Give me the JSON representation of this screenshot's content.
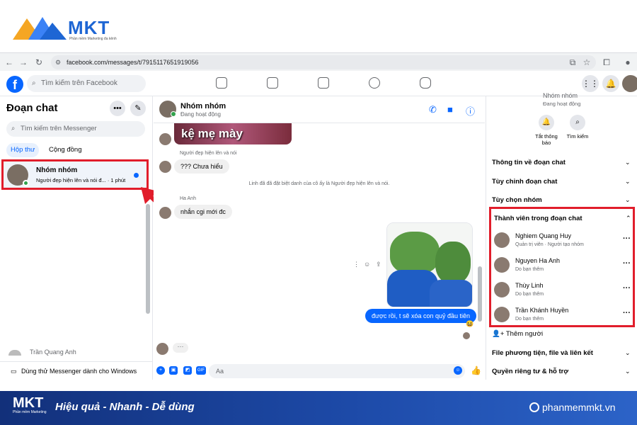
{
  "brand": {
    "logo": "MKT",
    "tagline": "Phần mềm Marketing đa kênh"
  },
  "browser": {
    "url": "facebook.com/messages/t/7915117651919056"
  },
  "fb": {
    "search_placeholder": "Tìm kiếm trên Facebook"
  },
  "left": {
    "title": "Đoạn chat",
    "search_placeholder": "Tìm kiếm trên Messenger",
    "tabs": [
      "Hộp thư",
      "Cộng đồng"
    ],
    "chat": {
      "name": "Nhóm nhóm",
      "preview": "Người đẹp hiện lên và nói đ... · 1 phút"
    },
    "last_chat": "Trần Quang Anh",
    "try_windows": "Dùng thử Messenger dành cho Windows"
  },
  "chat": {
    "name": "Nhóm nhóm",
    "status": "Đang hoạt động",
    "sticker_text": "kệ mẹ mày",
    "msg1_sender": "Người đẹp hiện lên và nói",
    "msg1": "??? Chưa hiểu",
    "system": "Linh đã đã đặt biệt danh của cô ấy là Người đẹp hiện lên và nói.",
    "msg2_sender": "Ha Anh",
    "msg2": "nhắn cgi mới đc",
    "my_msg": "được rồi, t sẽ xóa con quỷ đầu tiên",
    "reaction": "😆",
    "typing": "···",
    "input_placeholder": "Aa",
    "composer_gif": "GIF"
  },
  "right": {
    "name": "Nhóm nhóm",
    "status": "Đang hoạt động",
    "actions": [
      "Tắt thông báo",
      "Tìm kiếm"
    ],
    "sections": [
      "Thông tin về đoạn chat",
      "Tùy chỉnh đoạn chat",
      "Tùy chọn nhóm",
      "Thành viên trong đoạn chat"
    ],
    "members": [
      {
        "name": "Nghiem Quang Huy",
        "role": "Quản trị viên · Người tạo nhóm"
      },
      {
        "name": "Nguyen Ha Anh",
        "role": "Do bạn thêm"
      },
      {
        "name": "Thùy Linh",
        "role": "Do bạn thêm"
      },
      {
        "name": "Trần Khánh Huyền",
        "role": "Do bạn thêm"
      }
    ],
    "add_people": "Thêm người",
    "sections_after": [
      "File phương tiện, file và liên kết",
      "Quyền riêng tư & hỗ trợ"
    ]
  },
  "footer": {
    "logo": "MKT",
    "logo_sub": "Phần mềm Marketing",
    "slogan": "Hiệu quả - Nhanh  - Dễ dùng",
    "site": "phanmemmkt.vn"
  },
  "colors": {
    "accent": "#0866ff",
    "highlight": "#e11d2b",
    "footer_bg": "#1d4aa8"
  }
}
